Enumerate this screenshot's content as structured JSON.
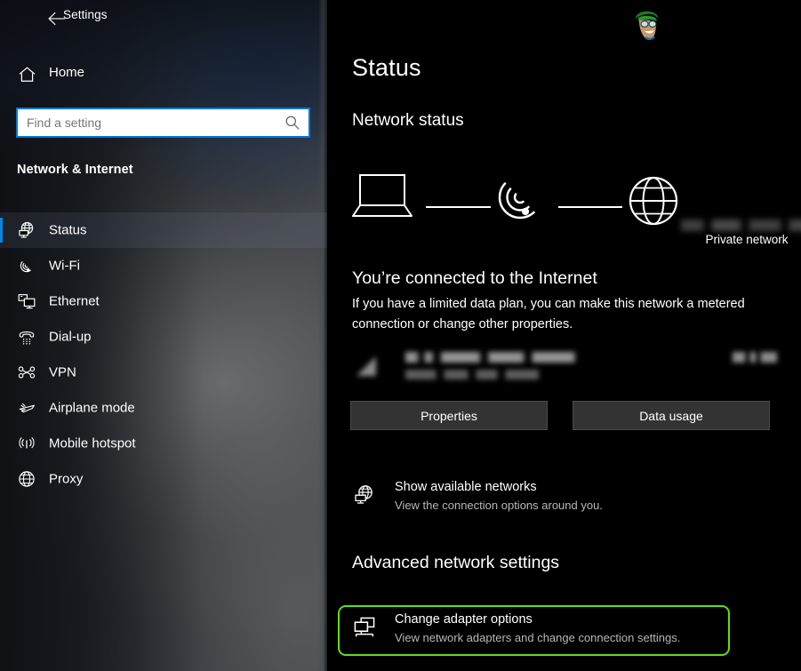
{
  "window": {
    "title": "Settings",
    "back_icon": "back-arrow-icon"
  },
  "sidebar": {
    "home": {
      "label": "Home",
      "icon": "home-icon"
    },
    "search": {
      "placeholder": "Find a setting",
      "value": "",
      "icon": "search-icon"
    },
    "section_header": "Network & Internet",
    "selected_item": "Status",
    "accent_color": "#0a84e0",
    "items": [
      {
        "label": "Status",
        "icon": "network-status-icon",
        "selected": true
      },
      {
        "label": "Wi-Fi",
        "icon": "wifi-icon",
        "selected": false
      },
      {
        "label": "Ethernet",
        "icon": "ethernet-icon",
        "selected": false
      },
      {
        "label": "Dial-up",
        "icon": "dial-up-phone-icon",
        "selected": false
      },
      {
        "label": "VPN",
        "icon": "vpn-icon",
        "selected": false
      },
      {
        "label": "Airplane mode",
        "icon": "airplane-icon",
        "selected": false
      },
      {
        "label": "Mobile hotspot",
        "icon": "mobile-hotspot-icon",
        "selected": false
      },
      {
        "label": "Proxy",
        "icon": "globe-icon",
        "selected": false
      }
    ]
  },
  "main": {
    "page_title": "Status",
    "network_status_heading": "Network status",
    "watermark": "cartoon-mascot-logo",
    "diagram": {
      "device_icon": "laptop-icon",
      "connection_icon": "wifi-icon",
      "internet_icon": "globe-icon",
      "network_name": "",
      "network_name_redacted": true,
      "network_type_label": "Private network"
    },
    "connected_title": "You’re connected to the Internet",
    "connected_description": "If you have a limited data plan, you can make this network a metered connection or change other properties.",
    "usage": {
      "adapter_icon": "wifi-signal-icon",
      "network_name": "",
      "period_label": "",
      "amount": "",
      "redacted": true
    },
    "buttons": {
      "properties": "Properties",
      "data_usage": "Data usage"
    },
    "links": [
      {
        "title": "Show available networks",
        "subtitle": "View the connection options around you.",
        "icon": "network-status-icon",
        "highlighted": false
      }
    ],
    "advanced_heading": "Advanced network settings",
    "advanced_links": [
      {
        "title": "Change adapter options",
        "subtitle": "View network adapters and change connection settings.",
        "icon": "adapter-options-icon",
        "highlighted": true
      }
    ],
    "highlight_color": "#5ce01a"
  }
}
